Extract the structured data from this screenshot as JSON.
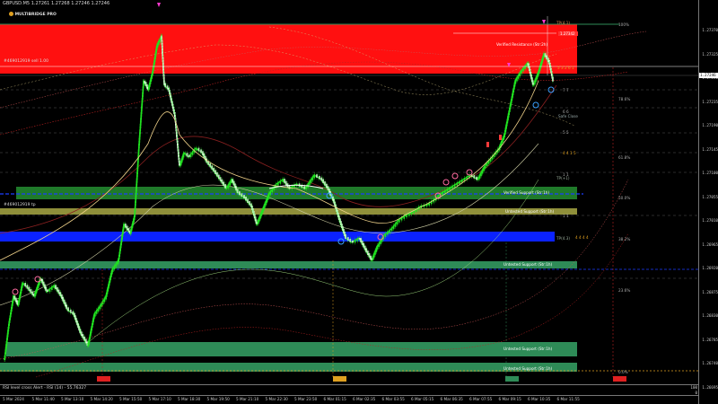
{
  "header": {
    "symbol": "GBPUSD.M5",
    "ohlc": "1.27261 1.27268 1.27246 1.27246",
    "brand": "MULTIBRIDGE PRO"
  },
  "order_labels": {
    "sell_order": "#469012919 sell 1.00",
    "tp_order": "#469012919 tp"
  },
  "zones": {
    "verified_resistance": "Verified Resistance (Str:2h)",
    "verified_support": "Verified Support (Str:1h)",
    "untested_support_1": "Untested Support (Str:1h)",
    "untested_support_2": "Untested Support (Str:1h)",
    "untested_support_3": "Untested Support (Str:1h)",
    "untested_support_4": "Untested Support (Str:1h)",
    "safe_close": "Safe Close"
  },
  "fib_levels": {
    "l100": "100%",
    "l786": "78.6%",
    "l618": "61.8%",
    "l500": "50.0%",
    "l382": "38.2%",
    "l236": "23.6%",
    "l000": "0.0%"
  },
  "digits": {
    "d1": "5 3 2 6 1",
    "d2": "7 7",
    "d3": "6 6",
    "d4": "5 5",
    "d5": "4 4 1 5",
    "d6": "4 4 4 4",
    "d7": "1 1",
    "d8": "1 1"
  },
  "markers": {
    "tp_top": "TP(4.1)",
    "tp_mid": "TP(+1)",
    "tp_low": "TP(4.3)"
  },
  "price_axis": [
    "1.27370",
    "1.27325",
    "1.27280",
    "1.27235",
    "1.27190",
    "1.27145",
    "1.27100",
    "1.27055",
    "1.27010",
    "1.26965",
    "1.26920",
    "1.26875",
    "1.26830",
    "1.26785",
    "1.26740",
    "1.26695"
  ],
  "current_price": "1.27246",
  "price_tags": {
    "top": "1.27342",
    "current": "1.27246"
  },
  "time_axis": [
    "5 Mar 2024",
    "5 Mar 11:40",
    "5 Mar 13:10",
    "5 Mar 14:20",
    "5 Mar 15:50",
    "5 Mar 17:10",
    "5 Mar 18:30",
    "5 Mar 19:50",
    "5 Mar 21:10",
    "5 Mar 22:30",
    "5 Mar 23:50",
    "6 Mar 01:15",
    "6 Mar 02:35",
    "6 Mar 03:55",
    "6 Mar 05:15",
    "6 Mar 06:35",
    "6 Mar 07:55",
    "6 Mar 09:15",
    "6 Mar 10:35",
    "6 Mar 11:55"
  ],
  "rsi": {
    "label": "RSI level cross Alert - RSI (14) - 55.76327",
    "level": "100",
    "bottom": "0"
  },
  "colors": {
    "resistance": "#ff1a1a",
    "support_green": "#2e8b57",
    "blue_band": "#0b22ff",
    "candle": "#21e321",
    "olive": "#8f8f3a"
  }
}
